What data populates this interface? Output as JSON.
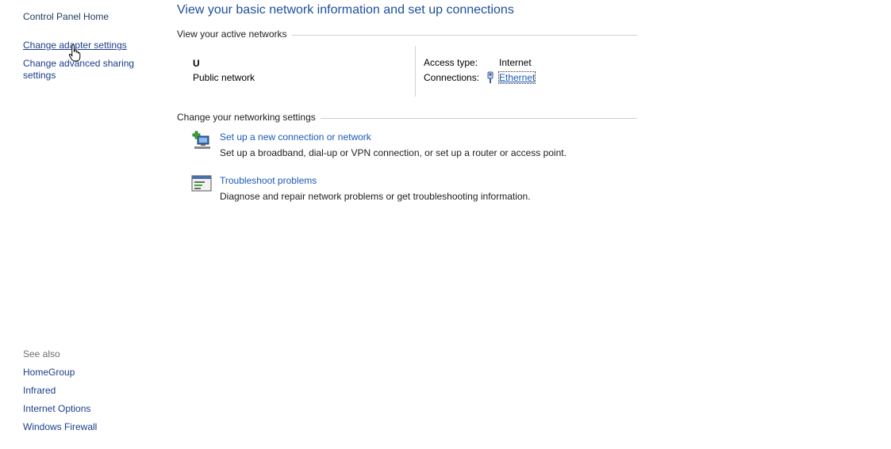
{
  "sidebar": {
    "home_label": "Control Panel Home",
    "items": [
      {
        "label": "Change adapter settings"
      },
      {
        "label": "Change advanced sharing",
        "label_line2": "settings"
      }
    ],
    "see_also_label": "See also",
    "see_also": [
      {
        "label": "HomeGroup"
      },
      {
        "label": "Infrared"
      },
      {
        "label": "Internet Options"
      },
      {
        "label": "Windows Firewall"
      }
    ]
  },
  "main": {
    "title": "View your basic network information and set up connections",
    "active_networks": {
      "heading": "View your active networks",
      "network_name": "U",
      "network_type": "Public network",
      "access_type_label": "Access type:",
      "access_type_value": "Internet",
      "connections_label": "Connections:",
      "connection_name": "Ethernet",
      "connection_icon": "ethernet-icon"
    },
    "networking_settings": {
      "heading": "Change your networking settings",
      "tasks": [
        {
          "icon": "new-connection-icon",
          "title": "Set up a new connection or network",
          "description": "Set up a broadband, dial-up or VPN connection, or set up a router or access point."
        },
        {
          "icon": "troubleshoot-icon",
          "title": "Troubleshoot problems",
          "description": "Diagnose and repair network problems or get troubleshooting information."
        }
      ]
    }
  }
}
